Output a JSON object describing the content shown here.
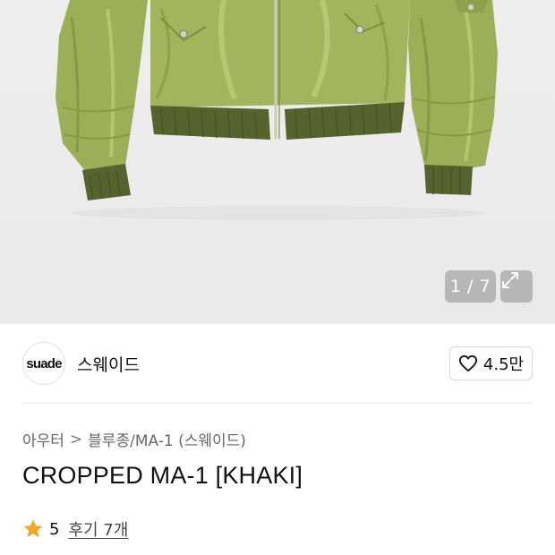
{
  "gallery": {
    "counter": "1 / 7",
    "image_subject": "khaki-ma1-jacket-photo",
    "colors": {
      "jacket": "#9caf57",
      "rib": "#55632c"
    }
  },
  "brand": {
    "logo_text": "suade",
    "name": "스웨이드",
    "likes": "4.5만"
  },
  "breadcrumb": {
    "items": [
      "아우터",
      "블루종/MA-1 (스웨이드)"
    ],
    "separator": ">"
  },
  "product": {
    "title": "CROPPED MA-1 [KHAKI]",
    "rating": "5",
    "reviews": "후기 7개",
    "star_color": "#f5a623"
  }
}
